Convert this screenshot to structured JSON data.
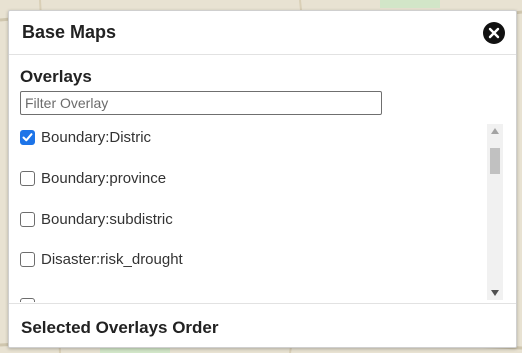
{
  "panel": {
    "title": "Base Maps",
    "close_icon": "close-icon"
  },
  "overlays": {
    "title": "Overlays",
    "filter": {
      "value": "",
      "placeholder": "Filter Overlay"
    },
    "items": [
      {
        "label": "Boundary:Distric",
        "checked": true
      },
      {
        "label": "Boundary:province",
        "checked": false
      },
      {
        "label": "Boundary:subdistric",
        "checked": false
      },
      {
        "label": "Disaster:risk_drought",
        "checked": false
      },
      {
        "label": "",
        "checked": false
      }
    ]
  },
  "footer": {
    "title": "Selected Overlays Order"
  },
  "colors": {
    "checkbox_checked": "#1d74e8",
    "close_button": "#111111"
  }
}
